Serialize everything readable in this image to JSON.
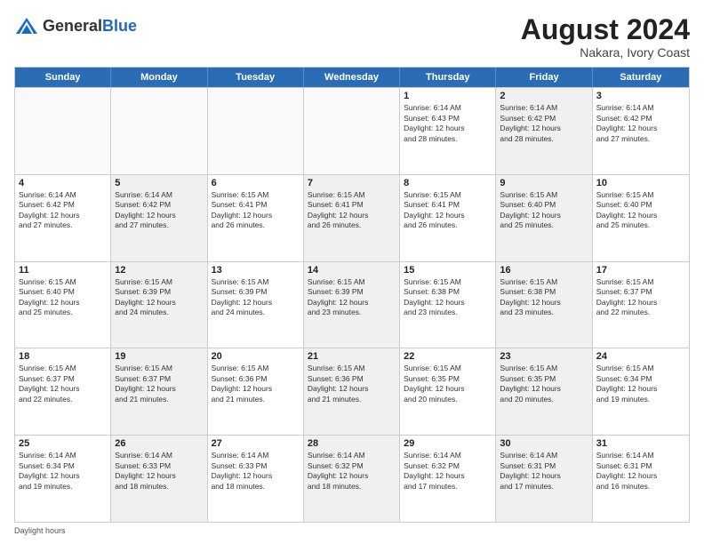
{
  "header": {
    "logo_general": "General",
    "logo_blue": "Blue",
    "month_title": "August 2024",
    "subtitle": "Nakara, Ivory Coast"
  },
  "footer": {
    "text": "Daylight hours"
  },
  "days_of_week": [
    "Sunday",
    "Monday",
    "Tuesday",
    "Wednesday",
    "Thursday",
    "Friday",
    "Saturday"
  ],
  "weeks": [
    [
      {
        "num": "",
        "info": "",
        "shaded": false,
        "empty": true
      },
      {
        "num": "",
        "info": "",
        "shaded": false,
        "empty": true
      },
      {
        "num": "",
        "info": "",
        "shaded": false,
        "empty": true
      },
      {
        "num": "",
        "info": "",
        "shaded": false,
        "empty": true
      },
      {
        "num": "1",
        "info": "Sunrise: 6:14 AM\nSunset: 6:43 PM\nDaylight: 12 hours\nand 28 minutes.",
        "shaded": false,
        "empty": false
      },
      {
        "num": "2",
        "info": "Sunrise: 6:14 AM\nSunset: 6:42 PM\nDaylight: 12 hours\nand 28 minutes.",
        "shaded": true,
        "empty": false
      },
      {
        "num": "3",
        "info": "Sunrise: 6:14 AM\nSunset: 6:42 PM\nDaylight: 12 hours\nand 27 minutes.",
        "shaded": false,
        "empty": false
      }
    ],
    [
      {
        "num": "4",
        "info": "Sunrise: 6:14 AM\nSunset: 6:42 PM\nDaylight: 12 hours\nand 27 minutes.",
        "shaded": false,
        "empty": false
      },
      {
        "num": "5",
        "info": "Sunrise: 6:14 AM\nSunset: 6:42 PM\nDaylight: 12 hours\nand 27 minutes.",
        "shaded": true,
        "empty": false
      },
      {
        "num": "6",
        "info": "Sunrise: 6:15 AM\nSunset: 6:41 PM\nDaylight: 12 hours\nand 26 minutes.",
        "shaded": false,
        "empty": false
      },
      {
        "num": "7",
        "info": "Sunrise: 6:15 AM\nSunset: 6:41 PM\nDaylight: 12 hours\nand 26 minutes.",
        "shaded": true,
        "empty": false
      },
      {
        "num": "8",
        "info": "Sunrise: 6:15 AM\nSunset: 6:41 PM\nDaylight: 12 hours\nand 26 minutes.",
        "shaded": false,
        "empty": false
      },
      {
        "num": "9",
        "info": "Sunrise: 6:15 AM\nSunset: 6:40 PM\nDaylight: 12 hours\nand 25 minutes.",
        "shaded": true,
        "empty": false
      },
      {
        "num": "10",
        "info": "Sunrise: 6:15 AM\nSunset: 6:40 PM\nDaylight: 12 hours\nand 25 minutes.",
        "shaded": false,
        "empty": false
      }
    ],
    [
      {
        "num": "11",
        "info": "Sunrise: 6:15 AM\nSunset: 6:40 PM\nDaylight: 12 hours\nand 25 minutes.",
        "shaded": false,
        "empty": false
      },
      {
        "num": "12",
        "info": "Sunrise: 6:15 AM\nSunset: 6:39 PM\nDaylight: 12 hours\nand 24 minutes.",
        "shaded": true,
        "empty": false
      },
      {
        "num": "13",
        "info": "Sunrise: 6:15 AM\nSunset: 6:39 PM\nDaylight: 12 hours\nand 24 minutes.",
        "shaded": false,
        "empty": false
      },
      {
        "num": "14",
        "info": "Sunrise: 6:15 AM\nSunset: 6:39 PM\nDaylight: 12 hours\nand 23 minutes.",
        "shaded": true,
        "empty": false
      },
      {
        "num": "15",
        "info": "Sunrise: 6:15 AM\nSunset: 6:38 PM\nDaylight: 12 hours\nand 23 minutes.",
        "shaded": false,
        "empty": false
      },
      {
        "num": "16",
        "info": "Sunrise: 6:15 AM\nSunset: 6:38 PM\nDaylight: 12 hours\nand 23 minutes.",
        "shaded": true,
        "empty": false
      },
      {
        "num": "17",
        "info": "Sunrise: 6:15 AM\nSunset: 6:37 PM\nDaylight: 12 hours\nand 22 minutes.",
        "shaded": false,
        "empty": false
      }
    ],
    [
      {
        "num": "18",
        "info": "Sunrise: 6:15 AM\nSunset: 6:37 PM\nDaylight: 12 hours\nand 22 minutes.",
        "shaded": false,
        "empty": false
      },
      {
        "num": "19",
        "info": "Sunrise: 6:15 AM\nSunset: 6:37 PM\nDaylight: 12 hours\nand 21 minutes.",
        "shaded": true,
        "empty": false
      },
      {
        "num": "20",
        "info": "Sunrise: 6:15 AM\nSunset: 6:36 PM\nDaylight: 12 hours\nand 21 minutes.",
        "shaded": false,
        "empty": false
      },
      {
        "num": "21",
        "info": "Sunrise: 6:15 AM\nSunset: 6:36 PM\nDaylight: 12 hours\nand 21 minutes.",
        "shaded": true,
        "empty": false
      },
      {
        "num": "22",
        "info": "Sunrise: 6:15 AM\nSunset: 6:35 PM\nDaylight: 12 hours\nand 20 minutes.",
        "shaded": false,
        "empty": false
      },
      {
        "num": "23",
        "info": "Sunrise: 6:15 AM\nSunset: 6:35 PM\nDaylight: 12 hours\nand 20 minutes.",
        "shaded": true,
        "empty": false
      },
      {
        "num": "24",
        "info": "Sunrise: 6:15 AM\nSunset: 6:34 PM\nDaylight: 12 hours\nand 19 minutes.",
        "shaded": false,
        "empty": false
      }
    ],
    [
      {
        "num": "25",
        "info": "Sunrise: 6:14 AM\nSunset: 6:34 PM\nDaylight: 12 hours\nand 19 minutes.",
        "shaded": false,
        "empty": false
      },
      {
        "num": "26",
        "info": "Sunrise: 6:14 AM\nSunset: 6:33 PM\nDaylight: 12 hours\nand 18 minutes.",
        "shaded": true,
        "empty": false
      },
      {
        "num": "27",
        "info": "Sunrise: 6:14 AM\nSunset: 6:33 PM\nDaylight: 12 hours\nand 18 minutes.",
        "shaded": false,
        "empty": false
      },
      {
        "num": "28",
        "info": "Sunrise: 6:14 AM\nSunset: 6:32 PM\nDaylight: 12 hours\nand 18 minutes.",
        "shaded": true,
        "empty": false
      },
      {
        "num": "29",
        "info": "Sunrise: 6:14 AM\nSunset: 6:32 PM\nDaylight: 12 hours\nand 17 minutes.",
        "shaded": false,
        "empty": false
      },
      {
        "num": "30",
        "info": "Sunrise: 6:14 AM\nSunset: 6:31 PM\nDaylight: 12 hours\nand 17 minutes.",
        "shaded": true,
        "empty": false
      },
      {
        "num": "31",
        "info": "Sunrise: 6:14 AM\nSunset: 6:31 PM\nDaylight: 12 hours\nand 16 minutes.",
        "shaded": false,
        "empty": false
      }
    ]
  ]
}
